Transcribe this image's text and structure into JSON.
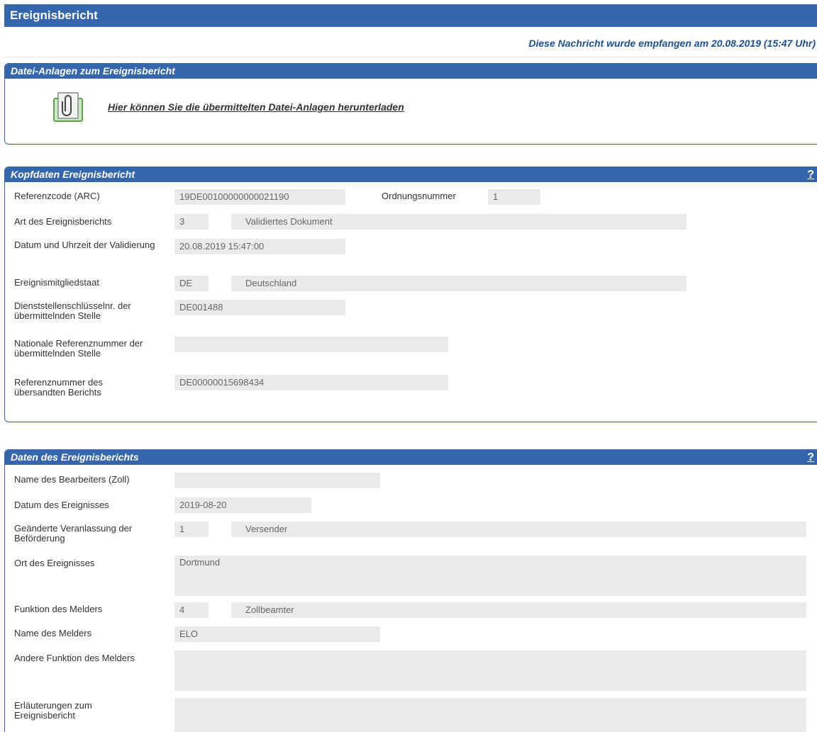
{
  "header": {
    "title": "Ereignisbericht",
    "received_text": "Diese Nachricht wurde empfangen am 20.08.2019 (15:47 Uhr)"
  },
  "attachments": {
    "title": "Datei-Anlagen zum Ereignisbericht",
    "icon": "paperclip-icon",
    "link_text": "Hier können Sie die übermittelten Datei-Anlagen herunterladen"
  },
  "kopfdaten": {
    "title": "Kopfdaten Ereignisbericht",
    "help": "?",
    "fields": {
      "arc_label": "Referenzcode (ARC)",
      "arc_value": "19DE00100000000021190",
      "ordnung_label": "Ordnungsnummer",
      "ordnung_value": "1",
      "art_label": "Art des Ereignisberichts",
      "art_code": "3",
      "art_text": "Validiertes Dokument",
      "datum_label": "Datum und Uhrzeit der Validierung",
      "datum_value": "20.08.2019 15:47:00",
      "staat_label": "Ereignismitgliedstaat",
      "staat_code": "DE",
      "staat_text": "Deutschland",
      "dienst_label": "Dienststellenschlüsselnr. der übermittelnden Stelle",
      "dienst_value": "DE001488",
      "natref_label": "Nationale Referenznummer der übermittelnden Stelle",
      "natref_value": "",
      "refnr_label": "Referenznummer des übersandten Berichts",
      "refnr_value": "DE00000015698434"
    }
  },
  "daten": {
    "title": "Daten des Ereignisberichts",
    "help": "?",
    "fields": {
      "bearbeiter_label": "Name des Bearbeiters (Zoll)",
      "bearbeiter_value": "",
      "datum_label": "Datum des Ereignisses",
      "datum_value": "2019-08-20",
      "veranlassung_label": "Geänderte Veranlassung der Beförderung",
      "veranlassung_code": "1",
      "veranlassung_text": "Versender",
      "ort_label": "Ort des Ereignisses",
      "ort_value": "Dortmund",
      "funktion_label": "Funktion des Melders",
      "funktion_code": "4",
      "funktion_text": "Zollbeamter",
      "melder_label": "Name des Melders",
      "melder_value": "ELO",
      "andere_label": "Andere Funktion des Melders",
      "andere_value": "",
      "erlaeut_label": "Erläuterungen zum Ereignisbericht",
      "erlaeut_value": ""
    }
  }
}
